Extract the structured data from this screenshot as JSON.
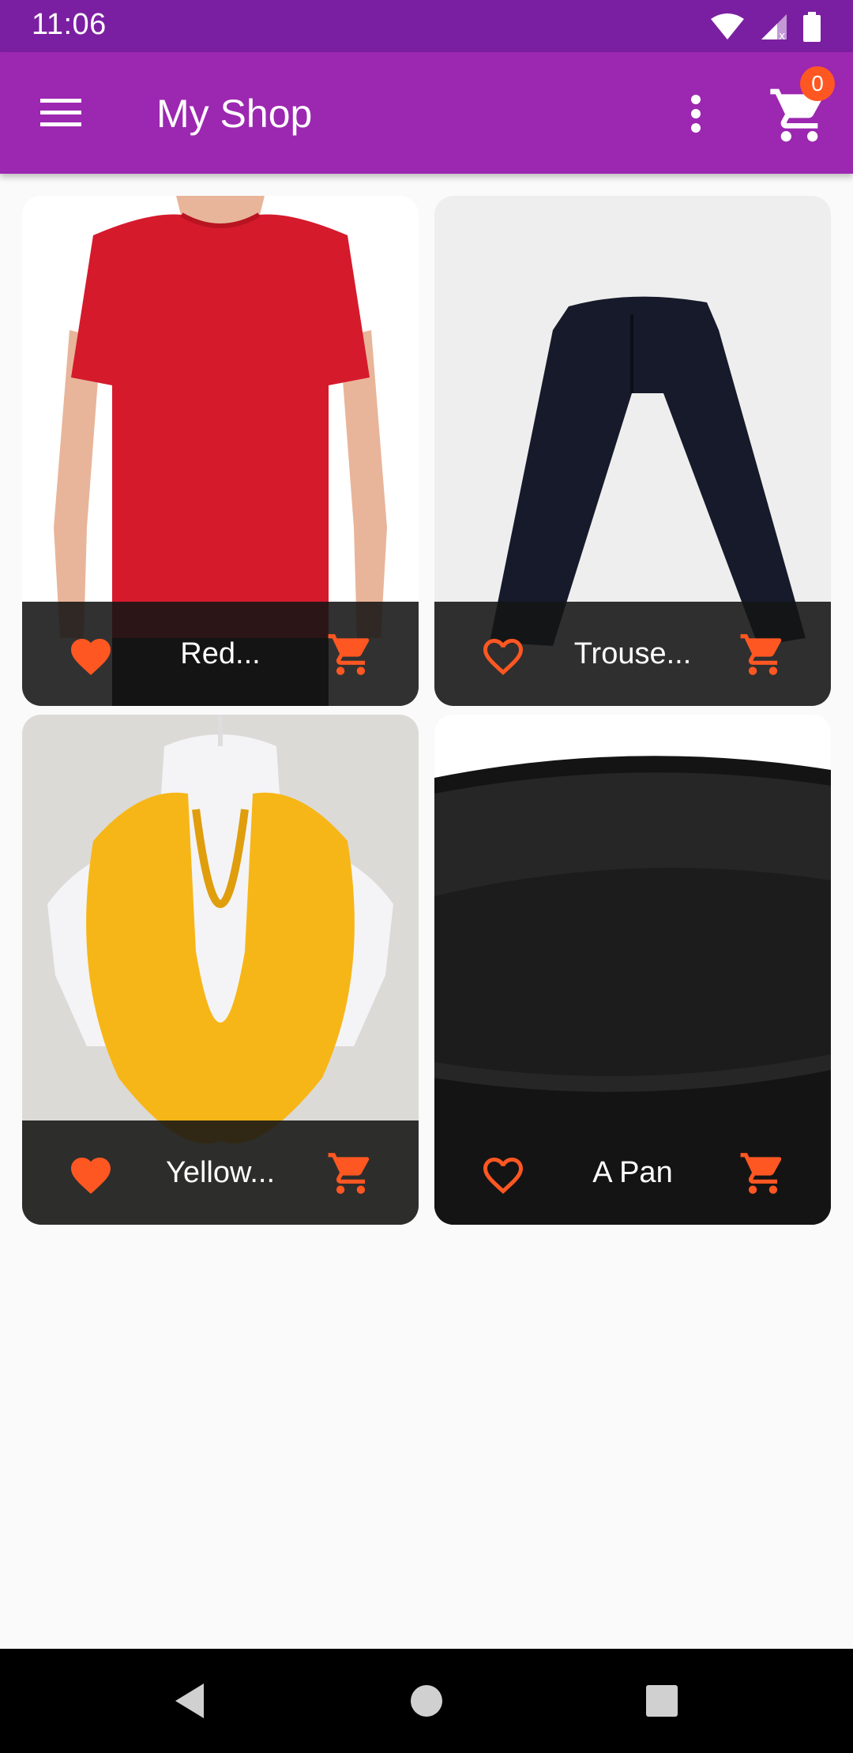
{
  "status_bar": {
    "time": "11:06"
  },
  "app_bar": {
    "title": "My Shop",
    "cart_count": "0"
  },
  "colors": {
    "primary": "#9c27b0",
    "primary_dark": "#7b1fa2",
    "accent": "#ff5722"
  },
  "products": [
    {
      "title": "Red...",
      "favorite": true,
      "image": "red-shirt"
    },
    {
      "title": "Trouse...",
      "favorite": false,
      "image": "trousers"
    },
    {
      "title": "Yellow...",
      "favorite": true,
      "image": "yellow-scarf"
    },
    {
      "title": "A Pan",
      "favorite": false,
      "image": "pan"
    }
  ]
}
